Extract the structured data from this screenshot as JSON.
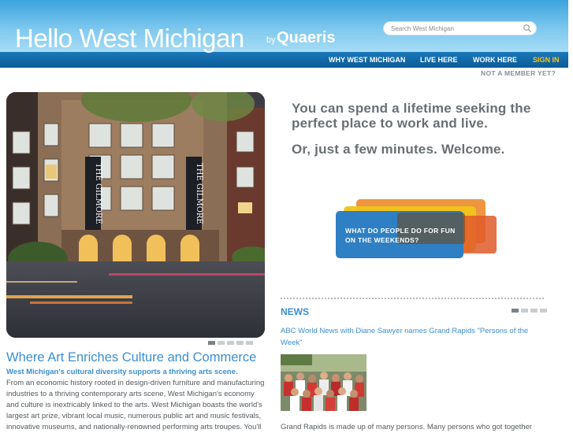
{
  "header": {
    "logo_text": "Hello West Michigan",
    "logo_by": "by",
    "logo_brand": "Quaeris",
    "search_placeholder": "Search West Michigan"
  },
  "nav": {
    "items": [
      "WHY WEST MICHIGAN",
      "LIVE HERE",
      "WORK HERE",
      "SIGN IN"
    ],
    "member_link": "NOT A MEMBER YET?"
  },
  "hero": {
    "banner_text": "THE GILMORE",
    "slide_active": 1,
    "slide_count": 5
  },
  "tagline": {
    "line1": "You can spend a lifetime seeking the perfect place to work and live.",
    "line2": "Or, just a few minutes. Welcome.",
    "bubble_text": "WHAT DO PEOPLE DO FOR FUN ON THE WEEKENDS?"
  },
  "article": {
    "title": "Where Art Enriches Culture and Commerce",
    "subtitle": "West Michigan's cultural diversity supports a thriving arts scene.",
    "body": "From an economic history rooted in design-driven furniture and manufacturing industries to a thriving contemporary arts scene, West Michigan's economy and culture is inextricably linked to the arts. West Michigan boasts the world's largest art prize, vibrant local music, numerous public art and music festivals, innovative museums, and nationally-renowned performing arts troupes. You'll"
  },
  "news": {
    "heading": "NEWS",
    "headline": "ABC World News with Diane Sawyer names Grand Rapids \"Persons of the Week\"",
    "body": "Grand Rapids is made up of many persons.  Many persons who got together",
    "slide_active": 1,
    "slide_count": 4
  },
  "colors": {
    "accent_blue": "#3b8fd0",
    "nav_bar": "#0b5b99",
    "sign_in": "#f5c416",
    "text_gray": "#555a5e"
  }
}
